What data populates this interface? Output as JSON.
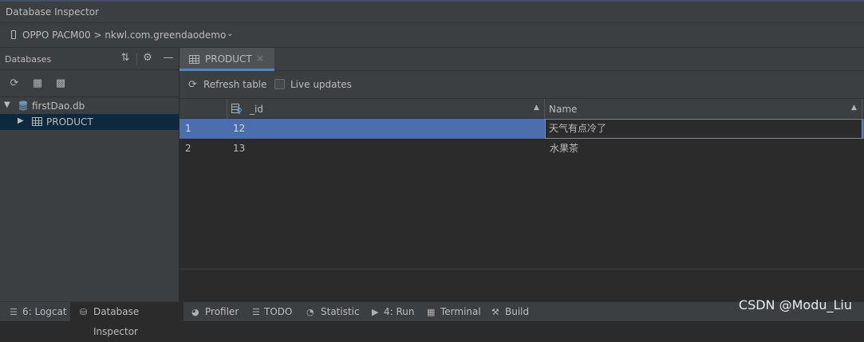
{
  "window": {
    "title": "Database Inspector"
  },
  "device": {
    "selector": "OPPO PACM00 > nkwl.com.greendaodemo"
  },
  "databases_panel": {
    "title": "Databases",
    "header_icons": [
      "collapse-icon",
      "gear-icon",
      "minimize-icon"
    ],
    "tool_icons": [
      "refresh-icon",
      "table-query-icon",
      "schema-icon"
    ],
    "tree": [
      {
        "label": "firstDao.db",
        "type": "database",
        "expanded": true
      },
      {
        "label": "PRODUCT",
        "type": "table",
        "selected": true
      }
    ]
  },
  "editor": {
    "tab_label": "PRODUCT",
    "tab_close": "×",
    "refresh_label": "Refresh table",
    "live_updates_label": "Live updates",
    "live_updates_checked": false
  },
  "table": {
    "columns": [
      "_id",
      "Name"
    ],
    "rows": [
      {
        "num": "1",
        "id": "12",
        "name": "天气有点冷了",
        "selected": true
      },
      {
        "num": "2",
        "id": "13",
        "name": "水果茶",
        "selected": false
      }
    ]
  },
  "statusbar": {
    "items": [
      {
        "label": "6: Logcat",
        "icon": "logcat-icon",
        "active": false
      },
      {
        "label": "Database Inspector",
        "icon": "database-icon",
        "active": true
      },
      {
        "label": "Profiler",
        "icon": "profiler-icon",
        "active": false
      },
      {
        "label": "TODO",
        "icon": "todo-icon",
        "active": false
      },
      {
        "label": "Statistic",
        "icon": "statistic-icon",
        "active": false
      },
      {
        "label": "4: Run",
        "icon": "run-icon",
        "active": false
      },
      {
        "label": "Terminal",
        "icon": "terminal-icon",
        "active": false
      },
      {
        "label": "Build",
        "icon": "build-icon",
        "active": false
      }
    ]
  },
  "watermark": "CSDN @Modu_Liu",
  "colors": {
    "background": "#2b2b2b",
    "panel": "#3c3f41",
    "selection": "#4b6eaf",
    "tree_selection": "#0d293e",
    "tab_underline": "#4a88c7",
    "text": "#bbbbbb"
  }
}
